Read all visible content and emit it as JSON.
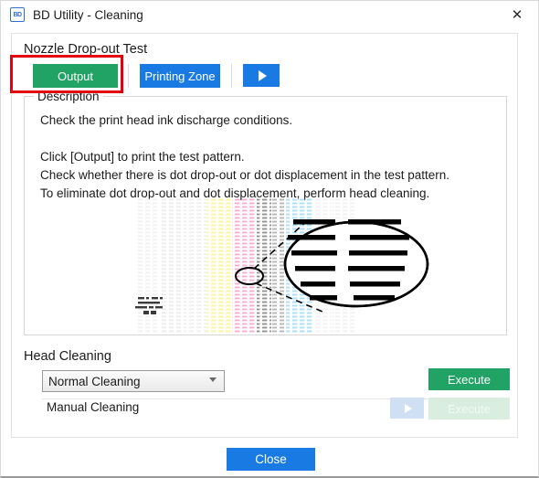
{
  "window": {
    "title": "BD Utility - Cleaning",
    "app_icon": "BD",
    "close_icon": "✕"
  },
  "nozzle_section": {
    "title": "Nozzle Drop-out Test",
    "output_button": "Output",
    "printing_zone_button": "Printing Zone",
    "play_button_icon": "play-triangle"
  },
  "description": {
    "legend": "Description",
    "body": "Check the print head ink discharge conditions.\n\nClick [Output] to print the test pattern.\nCheck whether there is dot drop-out or dot displacement in the test pattern.\nTo eliminate dot drop-out and dot displacement, perform head cleaning."
  },
  "pattern": {
    "alt": "nozzle-check-test-pattern",
    "bands": [
      {
        "name": "light-gray-1",
        "color": "#f2f2f2"
      },
      {
        "name": "light-gray-2",
        "color": "#ededed"
      },
      {
        "name": "yellow",
        "color": "#fbf59a"
      },
      {
        "name": "magenta",
        "color": "#f9b4d8"
      },
      {
        "name": "black",
        "color": "#9a9a9a"
      },
      {
        "name": "cyan",
        "color": "#a9e0f7"
      },
      {
        "name": "light-gray-3",
        "color": "#f2f2f2"
      }
    ]
  },
  "head_cleaning": {
    "title": "Head Cleaning",
    "select_value": "Normal Cleaning",
    "select_options": [
      "Normal Cleaning"
    ],
    "execute_button": "Execute",
    "manual_label": "Manual Cleaning",
    "manual_play_icon": "play-triangle",
    "manual_execute_button": "Execute"
  },
  "footer": {
    "close_button": "Close"
  },
  "colors": {
    "green": "#21a366",
    "blue": "#1a7ae4",
    "red_highlight": "#e3000f",
    "disabled_green": "#d9eede",
    "disabled_blue": "#cfe0f5"
  }
}
